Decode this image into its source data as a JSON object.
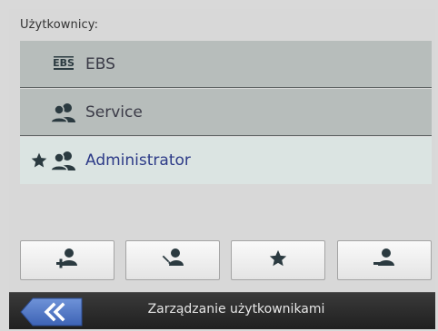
{
  "header": {
    "users_label": "Użytkownicy:"
  },
  "users": [
    {
      "name": "EBS",
      "icon": "ebs-logo-icon",
      "selected": false,
      "starred": false
    },
    {
      "name": "Service",
      "icon": "user-group-icon",
      "selected": false,
      "starred": false
    },
    {
      "name": "Administrator",
      "icon": "user-group-icon",
      "selected": true,
      "starred": true
    }
  ],
  "ebs_logo_text": "EBS",
  "toolbar": {
    "buttons": [
      {
        "icon": "add-user-icon"
      },
      {
        "icon": "edit-user-icon"
      },
      {
        "icon": "star-icon"
      },
      {
        "icon": "remove-user-icon"
      }
    ]
  },
  "footer": {
    "title": "Zarządzanie użytkownikami",
    "back_icon": "double-chevron-left-icon"
  },
  "colors": {
    "accent_blue": "#2c3a87",
    "row_normal": "#b7bdbb",
    "row_selected": "#dbe4e2",
    "icon_dark": "#2b3a40"
  }
}
